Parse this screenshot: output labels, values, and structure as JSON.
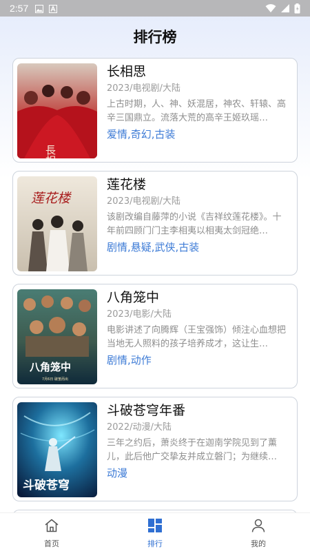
{
  "status_bar": {
    "time": "2:57"
  },
  "page": {
    "title": "排行榜"
  },
  "rankings": [
    {
      "title": "长相思",
      "meta": "2023/电视剧/大陆",
      "description": "上古时期，人、神、妖混居，神农、轩辕、高辛三国鼎立。流落大荒的高辛王姬玖瑶…",
      "tags": "爱情,奇幻,古装",
      "poster_text": "長相"
    },
    {
      "title": "莲花楼",
      "meta": "2023/电视剧/大陆",
      "description": "该剧改编自藤萍的小说《吉祥纹莲花楼》。十年前四顾门门主李相夷以相夷太剑冠绝…",
      "tags": "剧情,悬疑,武侠,古装",
      "poster_text": "莲花楼"
    },
    {
      "title": "八角笼中",
      "meta": "2023/电影/大陆",
      "description": "电影讲述了向腾辉（王宝强饰）倾注心血想把当地无人照料的孩子培养成才，这让生…",
      "tags": "剧情,动作",
      "poster_text": "八角笼中",
      "poster_date": "7月6日 破茧而出"
    },
    {
      "title": "斗破苍穹年番",
      "meta": "2022/动漫/大陆",
      "description": "三年之约后，萧炎终于在迦南学院见到了薰儿，此后他广交挚友并成立磐门；为继续…",
      "tags": "动漫",
      "poster_text": "斗破苍穹"
    }
  ],
  "tabs": [
    {
      "label": "首页",
      "icon": "home-icon",
      "active": false
    },
    {
      "label": "排行",
      "icon": "ranking-icon",
      "active": true
    },
    {
      "label": "我的",
      "icon": "user-icon",
      "active": false
    }
  ],
  "colors": {
    "accent": "#2f6fd2",
    "tag": "#3d7bd6",
    "status_bar": "#b7b7b9"
  }
}
